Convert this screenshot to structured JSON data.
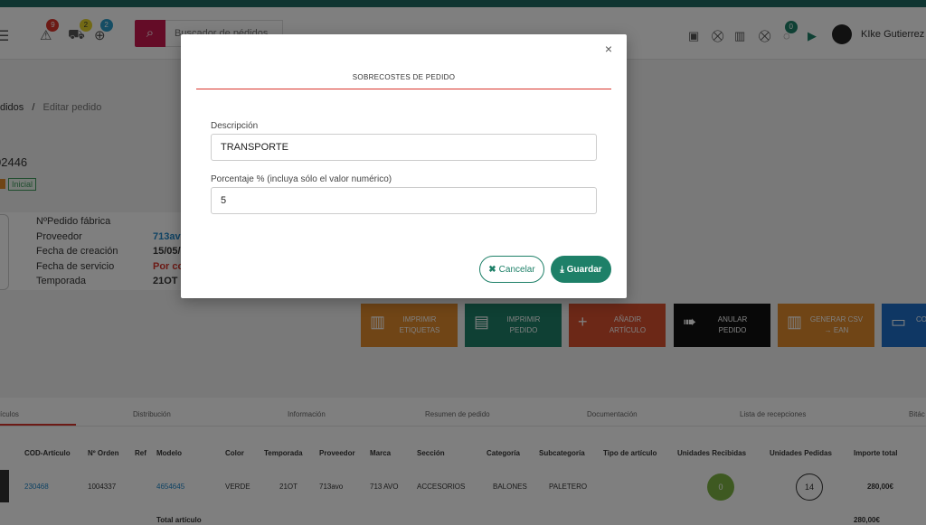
{
  "topbar": {
    "search_placeholder": "Buscador de pédidos",
    "badges": {
      "alerts": "9",
      "trucks": "2",
      "globe": "2",
      "chat": "0"
    },
    "user_name": "KIke Gutierrez"
  },
  "breadcrumb": {
    "parent": "didos",
    "separator": "/",
    "current": "Editar pedido"
  },
  "order": {
    "number": "02446",
    "status": "Inicial",
    "info": [
      {
        "label": "NºPedido fábrica",
        "value": ""
      },
      {
        "label": "Proveedor",
        "value": "713avo"
      },
      {
        "label": "Fecha de creación",
        "value": "15/05/"
      },
      {
        "label": "Fecha de servicio",
        "value": "Por co"
      },
      {
        "label": "Temporada",
        "value": "21OT"
      }
    ]
  },
  "actions": [
    {
      "label": "IMPRIMIR ETIQUETAS",
      "color": "#e08a2c",
      "icon": "barcode-icon"
    },
    {
      "label": "IMPRIMIR PEDIDO",
      "color": "#1e8068",
      "icon": "printer-icon"
    },
    {
      "label": "AÑADIR ARTÍCULO",
      "color": "#d9502f",
      "icon": "plus-icon"
    },
    {
      "label": "ANULAR PEDIDO",
      "color": "#111111",
      "icon": "arrow-right-icon"
    },
    {
      "label": "GENERAR CSV → EAN",
      "color": "#e08a2c",
      "icon": "barcode-icon"
    },
    {
      "label": "CO",
      "color": "#1e6fc8",
      "icon": "document-icon"
    }
  ],
  "tabs": [
    "ículos",
    "Distribución",
    "Información",
    "Resumen de pedido",
    "Documentación",
    "Lista de recepciones",
    "Bitác"
  ],
  "table": {
    "headers": [
      "COD-Artículo",
      "Nº Orden",
      "Ref",
      "Modelo",
      "Color",
      "Temporada",
      "Proveedor",
      "Marca",
      "Sección",
      "Categoría",
      "Subcategoría",
      "Tipo de artículo",
      "Unidades Recibidas",
      "Unidades Pedidas",
      "Importe total"
    ],
    "row": [
      "230468",
      "1004337",
      "",
      "4654645",
      "VERDE",
      "21OT",
      "713avo",
      "713 AVO",
      "ACCESORIOS",
      "BALONES",
      "PALETERO",
      "",
      "0",
      "14",
      "280,00€"
    ],
    "total_label": "Total artículo",
    "total_value": "280,00€"
  },
  "modal": {
    "title": "SOBRECOSTES DE PEDIDO",
    "close": "×",
    "fields": [
      {
        "label": "Descripción",
        "value": "TRANSPORTE"
      },
      {
        "label": "Porcentaje % (incluya sólo el valor numérico)",
        "value": "5"
      }
    ],
    "cancel_label": "Cancelar",
    "save_label": "Guardar"
  },
  "colors": {
    "accent": "#1e8068",
    "danger": "#d9342b",
    "brand": "#c8194f"
  }
}
